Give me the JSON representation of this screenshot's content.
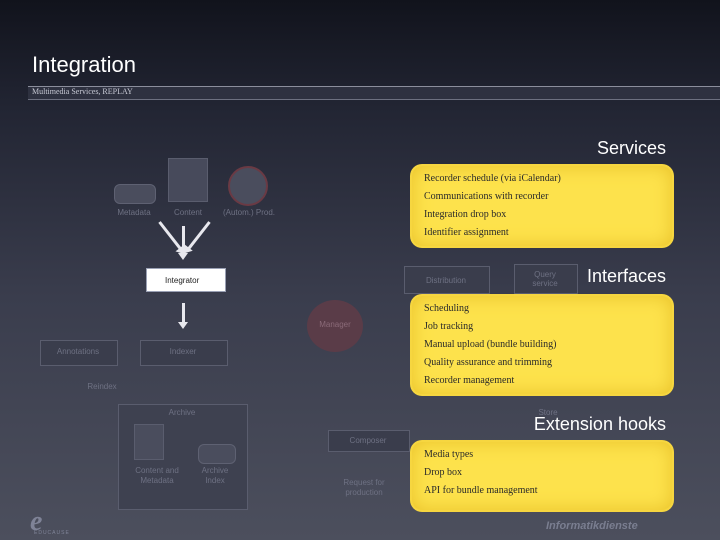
{
  "header": {
    "title": "Integration",
    "subtitle": "Multimedia Services, REPLAY"
  },
  "diagram": {
    "metadata": "Metadata",
    "content": "Content",
    "autom_prod": "(Autom.) Prod.",
    "integrator": "Integrator",
    "distribution": "Distribution",
    "query_service": "Query\nservice",
    "manager": "Manager",
    "annotations": "Annotations",
    "indexer": "Indexer",
    "reindex": "Reindex",
    "archive": "Archive",
    "composer": "Composer",
    "store": "Store",
    "content_and_metadata": "Content and\nMetadata",
    "archive_index": "Archive\nIndex",
    "request_for_production": "Request for\nproduction"
  },
  "services": {
    "label": "Services",
    "items": [
      "Recorder schedule (via iCalendar)",
      "Communications with recorder",
      "Integration drop box",
      "Identifier assignment"
    ]
  },
  "interfaces": {
    "label": "Interfaces",
    "items": [
      "Scheduling",
      "Job tracking",
      "Manual upload (bundle building)",
      "Quality assurance and trimming",
      "Recorder management"
    ]
  },
  "extension_hooks": {
    "label": "Extension hooks",
    "items": [
      "Media types",
      "Drop box",
      "API for bundle management"
    ]
  },
  "footer": {
    "logo_letter": "e",
    "logo_sub": "EDUCAUSE",
    "brand": "Informatikdienste"
  }
}
